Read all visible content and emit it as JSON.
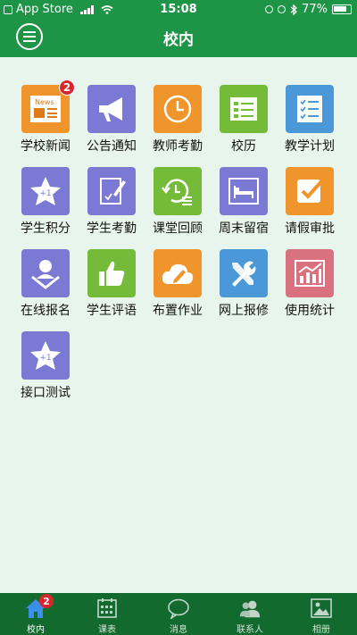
{
  "status": {
    "carrier": "App Store",
    "time": "15:08",
    "battery": "77%"
  },
  "header": {
    "title": "校内"
  },
  "colors": {
    "header": "#1e9447",
    "tabbar": "#136a2f",
    "background": "#e8f5ec",
    "badge": "#d9262c"
  },
  "apps": [
    {
      "label": "学校新闻",
      "icon": "news-icon",
      "color": "#f0952b",
      "badge": "2"
    },
    {
      "label": "公告通知",
      "icon": "megaphone-icon",
      "color": "#7a79d3"
    },
    {
      "label": "教师考勤",
      "icon": "clock-icon",
      "color": "#f0952b"
    },
    {
      "label": "校历",
      "icon": "calendar-list-icon",
      "color": "#75bb3a"
    },
    {
      "label": "教学计划",
      "icon": "checklist-icon",
      "color": "#4a98d8"
    },
    {
      "label": "学生积分",
      "icon": "star-icon",
      "color": "#7a79d3"
    },
    {
      "label": "学生考勤",
      "icon": "edit-doc-icon",
      "color": "#7a79d3"
    },
    {
      "label": "课堂回顾",
      "icon": "history-icon",
      "color": "#75bb3a"
    },
    {
      "label": "周末留宿",
      "icon": "bed-icon",
      "color": "#7a79d3"
    },
    {
      "label": "请假审批",
      "icon": "approve-icon",
      "color": "#f0952b"
    },
    {
      "label": "在线报名",
      "icon": "signup-icon",
      "color": "#7a79d3"
    },
    {
      "label": "学生评语",
      "icon": "thumbs-up-icon",
      "color": "#75bb3a"
    },
    {
      "label": "布置作业",
      "icon": "cloud-pen-icon",
      "color": "#f0952b"
    },
    {
      "label": "网上报修",
      "icon": "wrench-icon",
      "color": "#4a98d8"
    },
    {
      "label": "使用统计",
      "icon": "stats-icon",
      "color": "#d9727e"
    },
    {
      "label": "接口测试",
      "icon": "star-icon",
      "color": "#7a79d3"
    }
  ],
  "tabs": [
    {
      "label": "校内",
      "icon": "home-icon",
      "badge": "2",
      "active": true
    },
    {
      "label": "课表",
      "icon": "calendar-icon"
    },
    {
      "label": "消息",
      "icon": "chat-icon"
    },
    {
      "label": "联系人",
      "icon": "contacts-icon"
    },
    {
      "label": "相册",
      "icon": "photo-icon"
    }
  ]
}
